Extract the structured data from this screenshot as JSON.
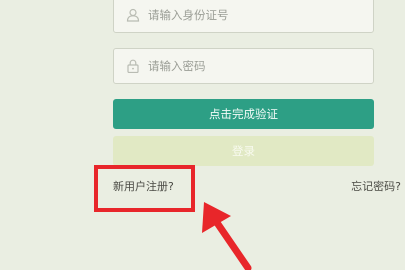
{
  "form": {
    "id_placeholder": "请输入身份证号",
    "password_placeholder": "请输入密码",
    "verify_button_label": "点击完成验证",
    "login_button_label": "登录",
    "register_link": "新用户注册?",
    "forgot_link": "忘记密码?"
  },
  "icons": {
    "id_field_icon": "user-icon",
    "password_field_icon": "lock-icon"
  },
  "annotation": {
    "box_color": "#e8262a",
    "arrow_color": "#e8262a"
  },
  "colors": {
    "background": "#eaeee2",
    "verify_button": "#2d9f85",
    "login_button": "#e1e9c4"
  }
}
